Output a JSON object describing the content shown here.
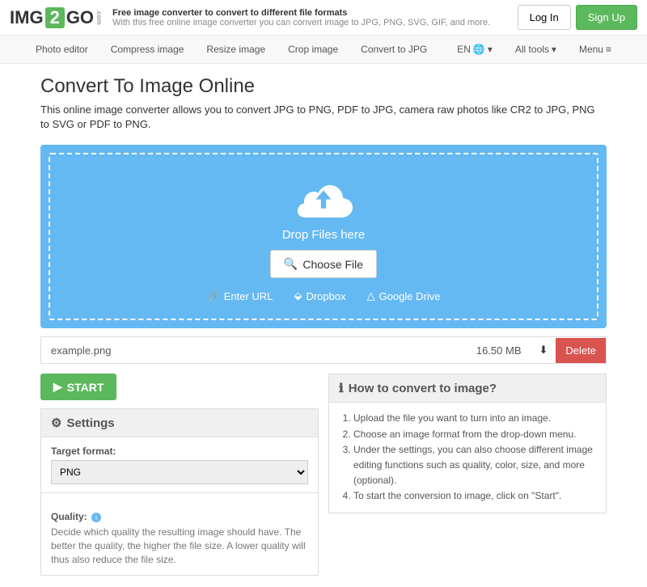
{
  "header": {
    "logo": {
      "p1": "IMG",
      "p2": "2",
      "p3": "GO",
      "p4": ".com"
    },
    "tagline1": "Free image converter to convert to different file formats",
    "tagline2": "With this free online image converter you can convert image to JPG, PNG, SVG, GIF, and more.",
    "login": "Log In",
    "signup": "Sign Up"
  },
  "nav": {
    "items": [
      "Photo editor",
      "Compress image",
      "Resize image",
      "Crop image",
      "Convert to JPG"
    ],
    "lang": "EN",
    "alltools": "All tools",
    "menu": "Menu"
  },
  "page": {
    "title": "Convert To Image Online",
    "desc": "This online image converter allows you to convert JPG to PNG, PDF to JPG, camera raw photos like CR2 to JPG, PNG to SVG or PDF to PNG."
  },
  "drop": {
    "text": "Drop Files here",
    "choose": "Choose File",
    "url": "Enter URL",
    "dropbox": "Dropbox",
    "gdrive": "Google Drive"
  },
  "file": {
    "name": "example.png",
    "size": "16.50 MB",
    "delete": "Delete"
  },
  "start": "START",
  "settings": {
    "title": "Settings",
    "target_label": "Target format:",
    "target_value": "PNG",
    "quality_label": "Quality:",
    "quality_text": "Decide which quality the resulting image should have. The better the quality, the higher the file size. A lower quality will thus also reduce the file size."
  },
  "howto": {
    "title": "How to convert to image?",
    "steps": [
      "Upload the file you want to turn into an image.",
      "Choose an image format from the drop-down menu.",
      "Under the settings, you can also choose different image editing functions such as quality, color, size, and more (optional).",
      "To start the conversion to image, click on \"Start\"."
    ]
  }
}
